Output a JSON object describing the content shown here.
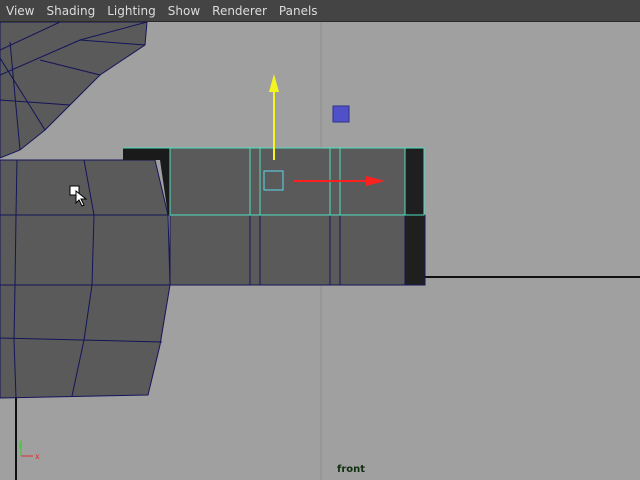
{
  "menu": {
    "items": [
      {
        "label": "View"
      },
      {
        "label": "Shading"
      },
      {
        "label": "Lighting"
      },
      {
        "label": "Show"
      },
      {
        "label": "Renderer"
      },
      {
        "label": "Panels"
      }
    ]
  },
  "viewport": {
    "camera_label": "front",
    "axis_labels": {
      "y": "y",
      "x": "x"
    },
    "colors": {
      "background": "#a0a0a0",
      "mesh_face": "#5a5a5a",
      "mesh_edge": "#14145a",
      "selection_edge": "#4de0c0",
      "manip_x": "#ff2020",
      "manip_y": "#f5f522",
      "manip_z_handle": "#5050c8"
    }
  }
}
